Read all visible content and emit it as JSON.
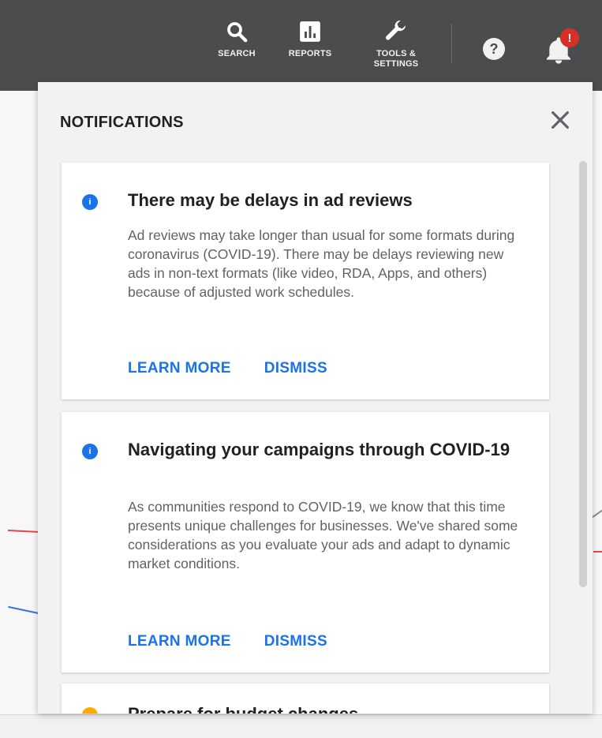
{
  "topbar": {
    "search_label": "SEARCH",
    "reports_label": "REPORTS",
    "tools_label": "TOOLS & SETTINGS",
    "help_symbol": "?",
    "notification_badge": "!"
  },
  "panel": {
    "title": "NOTIFICATIONS",
    "close_symbol": "✕",
    "cards": [
      {
        "icon": "info-icon",
        "title": "There may be delays in ad reviews",
        "body": "Ad reviews may take longer than usual for some formats during coronavirus (COVID-19). There may be delays reviewing new ads in non-text formats (like video, RDA, Apps, and others) because of adjusted work schedules.",
        "learn_more": "LEARN MORE",
        "dismiss": "DISMISS"
      },
      {
        "icon": "info-icon",
        "title": "Navigating your campaigns through COVID-19",
        "body": "As communities respond to COVID-19, we know that this time presents unique challenges for businesses. We've shared some considerations as you evaluate your ads and adapt to dynamic market conditions.",
        "learn_more": "LEARN MORE",
        "dismiss": "DISMISS"
      },
      {
        "icon": "warning-icon",
        "title": "Prepare for budget changes"
      }
    ]
  },
  "colors": {
    "topbar": "#4a4c4e",
    "accent": "#1a73e8",
    "badge": "#d93025"
  }
}
